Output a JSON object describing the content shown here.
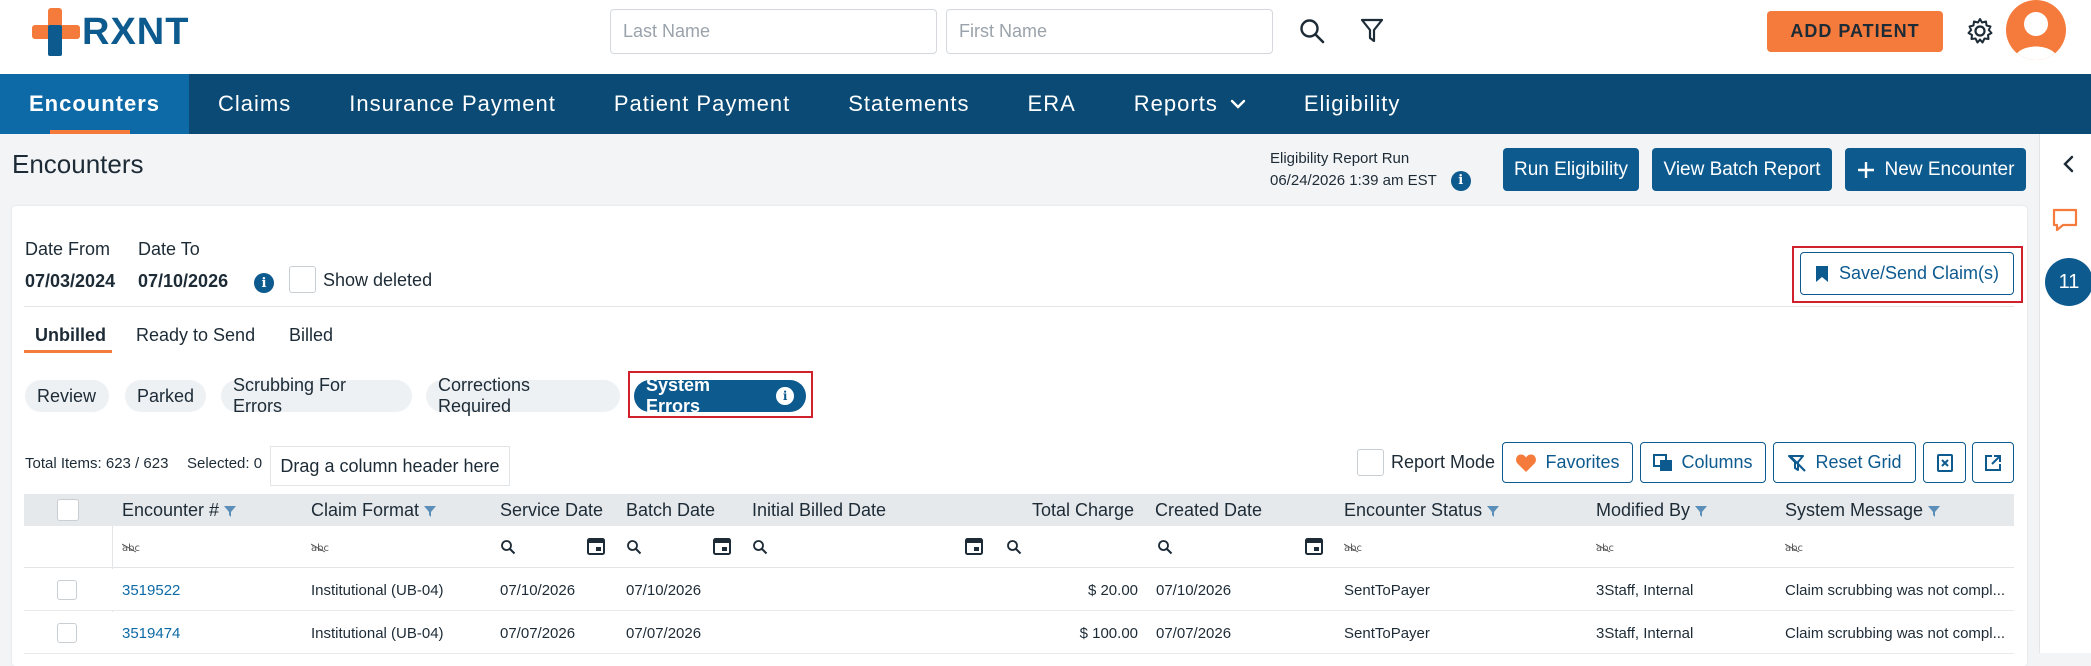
{
  "app": {
    "logo_text": "RXNT",
    "colors": {
      "brand_blue": "#0d5a8f",
      "nav_blue": "#0b4a74",
      "accent_orange": "#f47b3b",
      "highlight_red": "#d0202b"
    }
  },
  "header": {
    "last_name_placeholder": "Last Name",
    "first_name_placeholder": "First Name",
    "add_patient_label": "ADD PATIENT"
  },
  "nav": {
    "items": [
      {
        "label": "Encounters"
      },
      {
        "label": "Claims"
      },
      {
        "label": "Insurance Payment"
      },
      {
        "label": "Patient Payment"
      },
      {
        "label": "Statements"
      },
      {
        "label": "ERA"
      },
      {
        "label": "Reports"
      },
      {
        "label": "Eligibility"
      }
    ]
  },
  "page": {
    "title": "Encounters",
    "eligibility_run_label": "Eligibility Report Run",
    "eligibility_run_time": "06/24/2026 1:39 am EST",
    "run_eligibility_label": "Run Eligibility",
    "view_batch_label": "View Batch Report",
    "new_encounter_label": "New Encounter"
  },
  "rail": {
    "badge_count": "11"
  },
  "filters": {
    "date_from_label": "Date From",
    "date_from_value": "07/03/2024",
    "date_to_label": "Date To",
    "date_to_value": "07/10/2026",
    "show_deleted_label": "Show deleted",
    "save_send_label": "Save/Send Claim(s)"
  },
  "tabs": [
    {
      "label": "Unbilled"
    },
    {
      "label": "Ready to Send"
    },
    {
      "label": "Billed"
    }
  ],
  "pills": [
    {
      "label": "Review"
    },
    {
      "label": "Parked"
    },
    {
      "label": "Scrubbing For Errors"
    },
    {
      "label": "Corrections Required"
    },
    {
      "label": "System Errors"
    }
  ],
  "grid_toolbar": {
    "total_items": "Total Items: 623 / 623",
    "selected": "Selected: 0",
    "drag_hint": "Drag a column header here",
    "report_mode_label": "Report Mode",
    "favorites_label": "Favorites",
    "columns_label": "Columns",
    "reset_grid_label": "Reset Grid"
  },
  "grid": {
    "columns": [
      "Encounter #",
      "Claim Format",
      "Service Date",
      "Batch Date",
      "Initial Billed Date",
      "Total Charge",
      "Created Date",
      "Encounter Status",
      "Modified By",
      "System Message"
    ],
    "rows": [
      {
        "encounter": "3519522",
        "claim_format": "Institutional (UB-04)",
        "service_date": "07/10/2026",
        "batch_date": "07/10/2026",
        "initial_billed": "",
        "total_charge": "$ 20.00",
        "created_date": "07/10/2026",
        "status": "SentToPayer",
        "modified_by": "3Staff, Internal",
        "message": "Claim scrubbing was not compl..."
      },
      {
        "encounter": "3519474",
        "claim_format": "Institutional (UB-04)",
        "service_date": "07/07/2026",
        "batch_date": "07/07/2026",
        "initial_billed": "",
        "total_charge": "$ 100.00",
        "created_date": "07/07/2026",
        "status": "SentToPayer",
        "modified_by": "3Staff, Internal",
        "message": "Claim scrubbing was not compl..."
      }
    ]
  }
}
